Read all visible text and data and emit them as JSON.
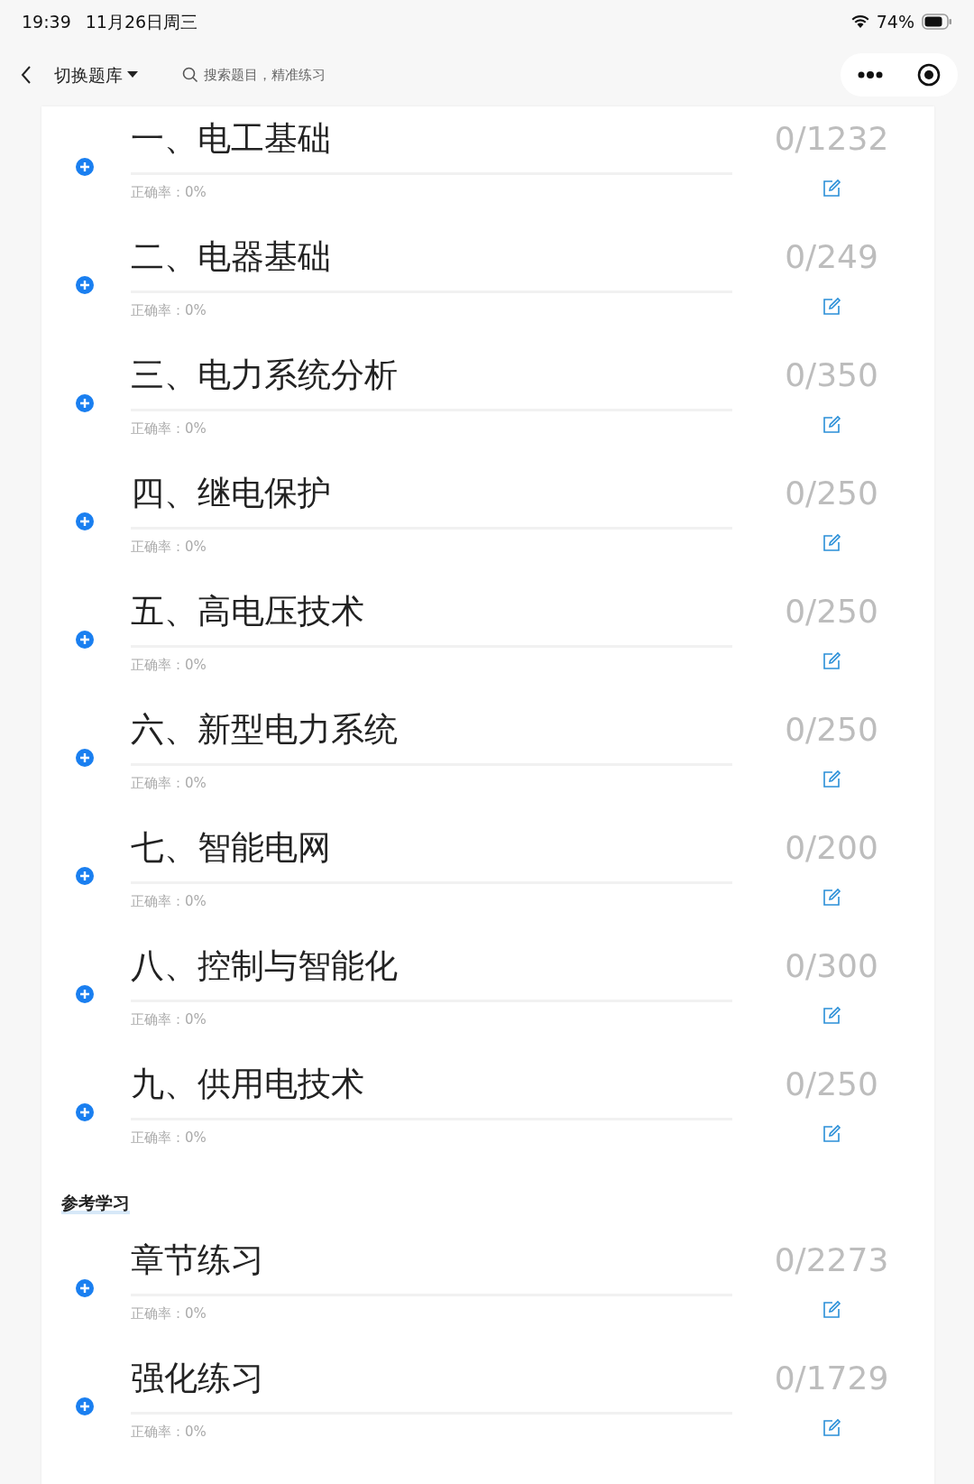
{
  "status_bar": {
    "time": "19:39",
    "date": "11月26日周三",
    "battery": "74%"
  },
  "nav_bar": {
    "title": "切换题库",
    "search": {
      "placeholder": "搜索题目，精准练习"
    }
  },
  "sections": [
    {
      "items": [
        {
          "title": "一、电工基础",
          "accuracy": "正确率：0%",
          "count": "0/1232"
        },
        {
          "title": "二、电器基础",
          "accuracy": "正确率：0%",
          "count": "0/249"
        },
        {
          "title": "三、电力系统分析",
          "accuracy": "正确率：0%",
          "count": "0/350"
        },
        {
          "title": "四、继电保护",
          "accuracy": "正确率：0%",
          "count": "0/250"
        },
        {
          "title": "五、高电压技术",
          "accuracy": "正确率：0%",
          "count": "0/250"
        },
        {
          "title": "六、新型电力系统",
          "accuracy": "正确率：0%",
          "count": "0/250"
        },
        {
          "title": "七、智能电网",
          "accuracy": "正确率：0%",
          "count": "0/200"
        },
        {
          "title": "八、控制与智能化",
          "accuracy": "正确率：0%",
          "count": "0/300"
        },
        {
          "title": "九、供用电技术",
          "accuracy": "正确率：0%",
          "count": "0/250"
        }
      ]
    },
    {
      "heading": "参考学习",
      "items": [
        {
          "title": "章节练习",
          "accuracy": "正确率：0%",
          "count": "0/2273"
        },
        {
          "title": "强化练习",
          "accuracy": "正确率：0%",
          "count": "0/1729"
        }
      ]
    }
  ]
}
